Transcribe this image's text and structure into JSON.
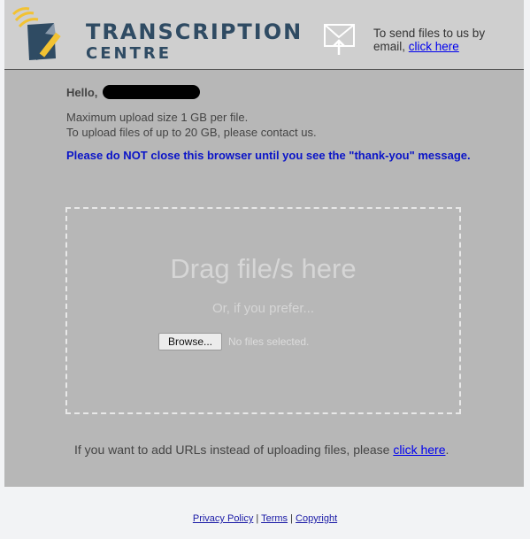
{
  "header": {
    "brand_line1": "TRANSCRIPTION",
    "brand_line2": "CENTRE",
    "send_text": "To send files to us by email,",
    "send_link": "click here"
  },
  "main": {
    "greeting": "Hello,",
    "info_line1": "Maximum upload size 1 GB per file.",
    "info_line2": "To upload files of up to 20 GB, please contact us.",
    "warning": "Please do NOT close this browser until you see the \"thank-you\" message."
  },
  "dropzone": {
    "title": "Drag file/s here",
    "subtitle": "Or, if you prefer...",
    "browse_label": "Browse...",
    "file_status": "No files selected."
  },
  "urls": {
    "text": "If you want to add URLs instead of uploading files, please",
    "link": "click here",
    "suffix": "."
  },
  "footer": {
    "privacy": "Privacy Policy",
    "terms": "Terms",
    "copyright": "Copyright",
    "separator": "|"
  },
  "colors": {
    "brand": "#2f4b63",
    "accent_yellow": "#f2c232",
    "warning_blue": "#0a14c8",
    "link": "#0000ee",
    "panel": "#b7b7b7",
    "header_bg": "#cfcfcf"
  },
  "icons": [
    "transcription-centre-logo-icon",
    "mail-upload-icon"
  ]
}
